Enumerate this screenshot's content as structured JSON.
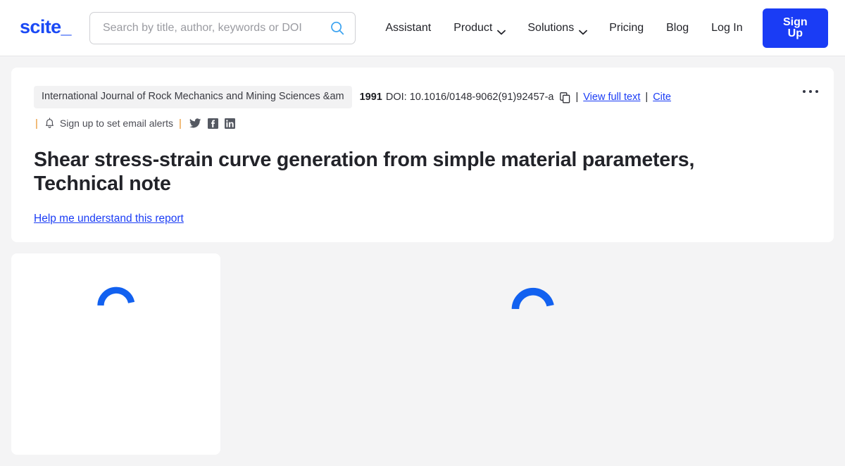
{
  "header": {
    "logo_text": "scite_",
    "search": {
      "placeholder": "Search by title, author, keywords or DOI",
      "value": "",
      "icon": "search-icon"
    },
    "nav_items": [
      {
        "label": "Assistant",
        "has_chevron": false
      },
      {
        "label": "Product",
        "has_chevron": true
      },
      {
        "label": "Solutions",
        "has_chevron": true
      },
      {
        "label": "Pricing",
        "has_chevron": false
      },
      {
        "label": "Blog",
        "has_chevron": false
      },
      {
        "label": "Log In",
        "has_chevron": false
      }
    ],
    "signup_label": "Sign Up"
  },
  "paper": {
    "journal": "International Journal of Rock Mechanics and Mining Sciences &am",
    "year": "1991",
    "doi_label": "DOI: 10.1016/0148-9062(91)92457-a",
    "copy_icon": "copy-icon",
    "separator": "|",
    "view_full_text": "View full text",
    "cite": "Cite",
    "alerts_pipe": "|",
    "bell_icon": "bell-icon",
    "alerts_label": "Sign up to set email alerts",
    "social": [
      {
        "name": "twitter-icon",
        "label": "Twitter"
      },
      {
        "name": "facebook-icon",
        "label": "Facebook"
      },
      {
        "name": "linkedin-icon",
        "label": "LinkedIn"
      }
    ],
    "title": "Shear stress-strain curve generation from simple material parameters, Technical note",
    "help_link": "Help me understand this report",
    "menu_icon": "more-options-icon"
  },
  "lower": {
    "left_panel": {
      "state": "loading",
      "spinner": "loading-spinner"
    },
    "right_panel": {
      "state": "loading",
      "spinner": "loading-spinner"
    }
  },
  "colors": {
    "brand_blue": "#1a49f5",
    "button_blue": "#1a3cf5",
    "link_blue": "#1a3cf5",
    "search_icon_blue": "#3aa2f0",
    "accent_orange": "#e8932a",
    "page_bg": "#f4f4f5",
    "badge_bg": "#f2f2f3",
    "text_dark": "#222329",
    "text_muted": "#4c4d55"
  }
}
